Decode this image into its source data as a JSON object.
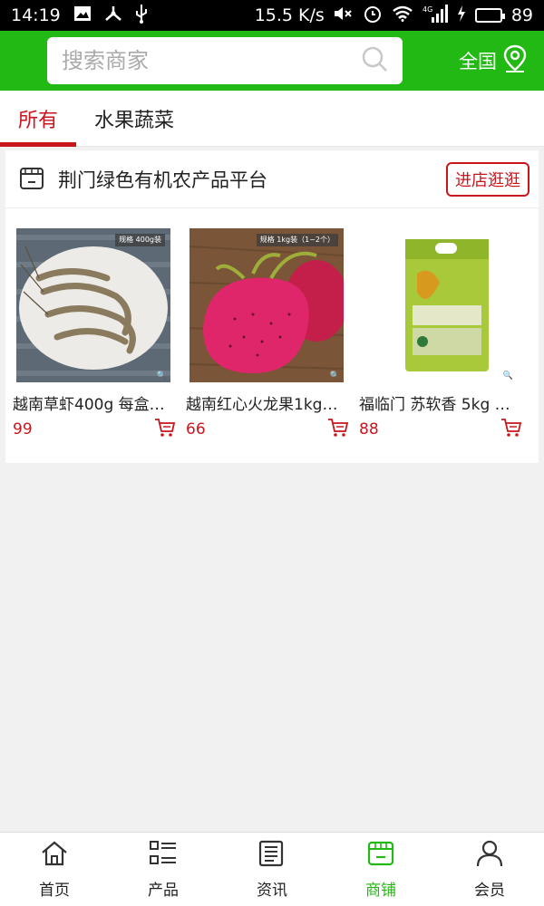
{
  "status_bar": {
    "time": "14:19",
    "speed": "15.5 K/s",
    "network": "4G",
    "battery": "89"
  },
  "header": {
    "search_placeholder": "搜索商家",
    "region_label": "全国",
    "accent_color": "#22b914"
  },
  "tabs": [
    {
      "label": "所有",
      "active": true
    },
    {
      "label": "水果蔬菜",
      "active": false
    }
  ],
  "shop": {
    "name": "荆门绿色有机农产品平台",
    "visit_label": "进店逛逛",
    "products": [
      {
        "title": "越南草虾400g 每盒…",
        "price": "99",
        "tag": "规格 400g装"
      },
      {
        "title": "越南红心火龙果1kg…",
        "price": "66",
        "tag": "规格 1kg装（1~2个）"
      },
      {
        "title": "福临门 苏软香 5kg …",
        "price": "88",
        "tag": ""
      }
    ]
  },
  "bottom_nav": [
    {
      "label": "首页",
      "icon": "home-icon",
      "active": false
    },
    {
      "label": "产品",
      "icon": "list-icon",
      "active": false
    },
    {
      "label": "资讯",
      "icon": "news-icon",
      "active": false
    },
    {
      "label": "商铺",
      "icon": "store-icon",
      "active": true
    },
    {
      "label": "会员",
      "icon": "user-icon",
      "active": false
    }
  ]
}
